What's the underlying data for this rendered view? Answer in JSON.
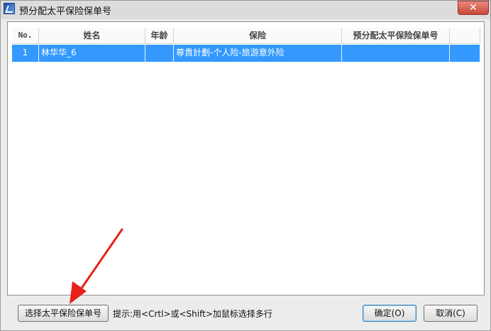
{
  "window": {
    "title": "预分配太平保险保单号"
  },
  "table": {
    "columns": [
      "No.",
      "姓名",
      "年龄",
      "保险",
      "预分配太平保险保单号"
    ],
    "rows": [
      {
        "no": "1",
        "name": "林华华_6",
        "age": "",
        "insurance": "尊貴計劃-个人险-旅游意外险",
        "policy": ""
      }
    ]
  },
  "footer": {
    "select_button": "选择太平保险保单号",
    "hint": "提示:用<Crtl>或<Shift>加鼠标选择多行",
    "ok_button": "确定(O)",
    "cancel_button": "取消(C)"
  },
  "colors": {
    "selection": "#3399ff",
    "annotation_arrow": "#e8211b"
  },
  "icons": {
    "app": "app-icon",
    "close": "close-icon"
  }
}
